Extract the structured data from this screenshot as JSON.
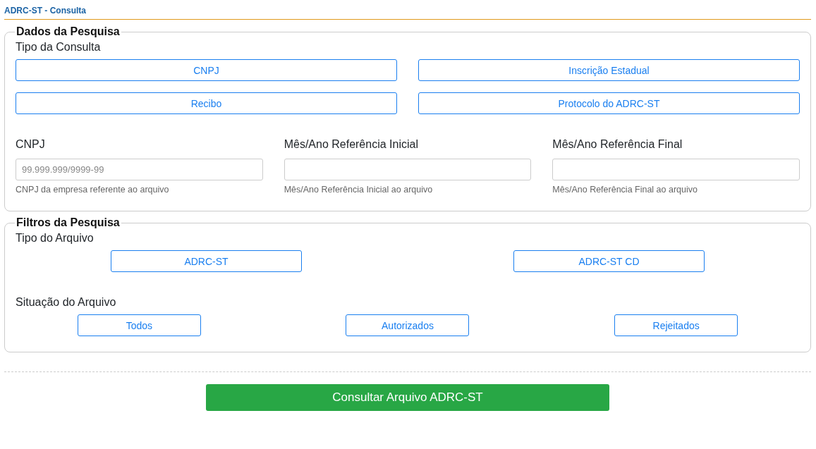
{
  "header": {
    "title": "ADRC-ST - Consulta"
  },
  "dados_pesquisa": {
    "legend": "Dados da Pesquisa",
    "tipo_consulta": {
      "label": "Tipo da Consulta",
      "options": [
        {
          "label": "CNPJ",
          "selected": false
        },
        {
          "label": "Inscrição Estadual",
          "selected": false
        },
        {
          "label": "Recibo",
          "selected": false
        },
        {
          "label": "Protocolo do ADRC-ST",
          "selected": false
        }
      ]
    },
    "fields": [
      {
        "label": "CNPJ",
        "placeholder": "99.999.999/9999-99",
        "help": "CNPJ da empresa referente ao arquivo"
      },
      {
        "label": "Mês/Ano Referência Inicial",
        "help": "Mês/Ano Referência Inicial ao arquivo"
      },
      {
        "label": "Mês/Ano Referência Final",
        "help": "Mês/Ano Referência Final ao arquivo"
      }
    ]
  },
  "filtros_pesquisa": {
    "legend": "Filtros da Pesquisa",
    "tipo_arquivo": {
      "label": "Tipo do Arquivo",
      "options": [
        {
          "label": "ADRC-ST",
          "selected": false
        },
        {
          "label": "ADRC-ST CD",
          "selected": false
        }
      ]
    },
    "situacao_arquivo": {
      "label": "Situação do Arquivo",
      "options": [
        {
          "label": "Todos",
          "selected": false
        },
        {
          "label": "Autorizados",
          "selected": false
        },
        {
          "label": "Rejeitados",
          "selected": false
        }
      ]
    }
  },
  "submit_button": "Consultar Arquivo ADRC-ST"
}
